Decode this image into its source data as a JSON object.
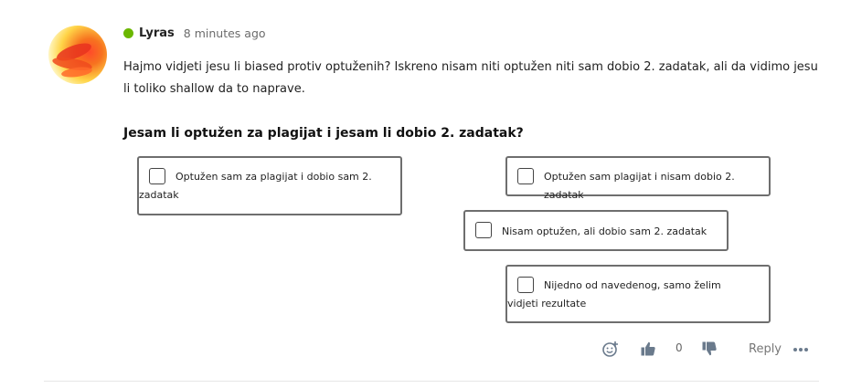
{
  "comment": {
    "author": "Lyras",
    "status_color": "#6bb700",
    "time": "8 minutes ago",
    "body": "Hajmo vidjeti jesu li biased protiv optuženih? Iskreno nisam niti optužen niti sam dobio 2. zadatak, ali da vidimo jesu li toliko shallow da to naprave."
  },
  "poll": {
    "question": "Jesam li optužen za plagijat i jesam li dobio 2. zadatak?",
    "options": [
      {
        "label": "Optužen sam za plagijat i dobio sam 2. zadatak",
        "checked": false
      },
      {
        "label": "Optužen sam plagijat i nisam dobio 2. zadatak",
        "checked": false
      },
      {
        "label": "Nisam optužen, ali dobio sam 2. zadatak",
        "checked": false
      },
      {
        "label": "Nijedno od navedenog, samo želim vidjeti rezultate",
        "checked": false
      }
    ]
  },
  "actions": {
    "add_reaction_icon": "emoji-add-icon",
    "like_icon": "thumbs-up-icon",
    "like_count": "0",
    "dislike_icon": "thumbs-down-icon",
    "reply_label": "Reply",
    "more_icon": "more-options-icon"
  }
}
